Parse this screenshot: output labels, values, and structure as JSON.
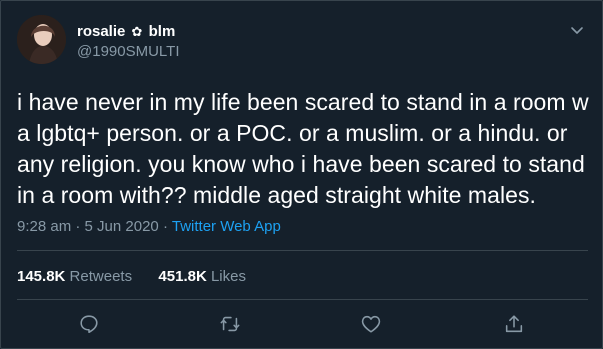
{
  "user": {
    "display_name": "rosalie",
    "name_suffix": "blm",
    "flower": "✿",
    "handle": "@1990SMULTI"
  },
  "tweet": {
    "text": "i have never in my life been scared to stand in a room w a lgbtq+ person. or a POC. or a muslim. or a hindu. or any religion. you know who i have been scared to stand in a room with?? middle aged straight white males.",
    "time": "9:28 am",
    "separator": "·",
    "date": "5 Jun 2020",
    "source": "Twitter Web App"
  },
  "stats": {
    "retweets_count": "145.8K",
    "retweets_label": "Retweets",
    "likes_count": "451.8K",
    "likes_label": "Likes"
  },
  "actions": {
    "icons": [
      "reply-icon",
      "retweet-icon",
      "like-icon",
      "share-icon"
    ]
  },
  "colors": {
    "background": "#15202b",
    "border": "#38444d",
    "secondary_text": "#8899a6",
    "link": "#1da1f2"
  }
}
